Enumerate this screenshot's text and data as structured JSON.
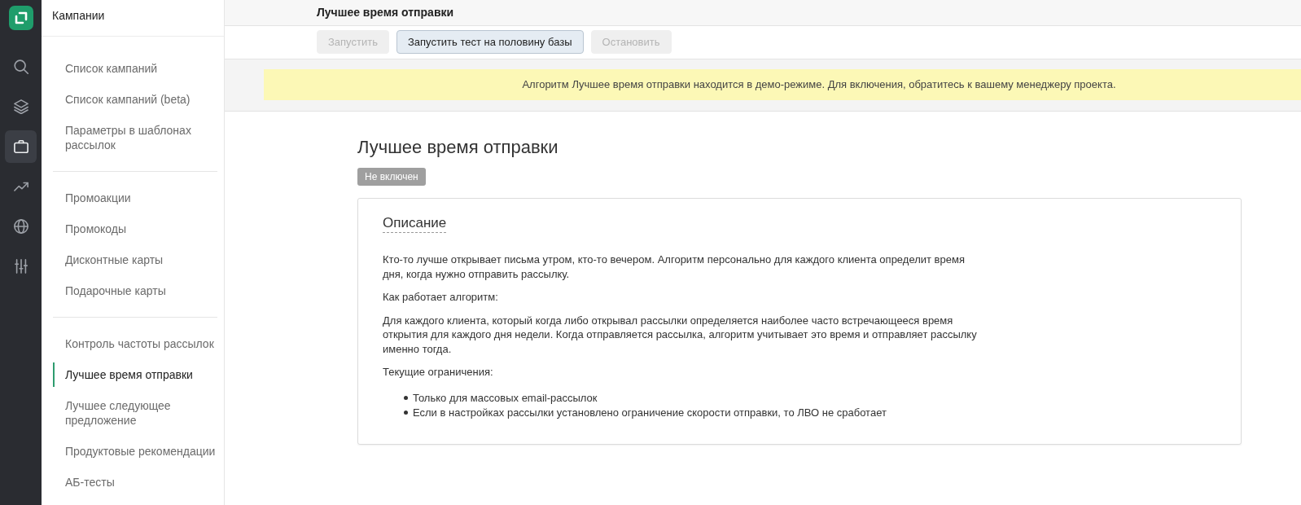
{
  "rail": {
    "items": [
      {
        "selected": false
      },
      {
        "selected": false
      },
      {
        "selected": true
      },
      {
        "selected": false
      },
      {
        "selected": false
      },
      {
        "selected": false
      }
    ]
  },
  "sidebar": {
    "title": "Кампании",
    "groups": [
      {
        "items": [
          {
            "label": "Список кампаний",
            "selected": false
          },
          {
            "label": "Список кампаний (beta)",
            "selected": false
          },
          {
            "label": "Параметры в шаблонах рассылок",
            "selected": false
          }
        ]
      },
      {
        "items": [
          {
            "label": "Промоакции",
            "selected": false
          },
          {
            "label": "Промокоды",
            "selected": false
          },
          {
            "label": "Дисконтные карты",
            "selected": false
          },
          {
            "label": "Подарочные карты",
            "selected": false
          }
        ]
      },
      {
        "items": [
          {
            "label": "Контроль частоты рассылок",
            "selected": false
          },
          {
            "label": "Лучшее время отправки",
            "selected": true
          },
          {
            "label": "Лучшее следующее предложение",
            "selected": false
          },
          {
            "label": "Продуктовые рекомендации",
            "selected": false
          },
          {
            "label": "АБ-тесты",
            "selected": false
          }
        ]
      }
    ]
  },
  "topbar": {
    "title": "Лучшее время отправки",
    "buttons": [
      {
        "label": "Запустить",
        "disabled": true
      },
      {
        "label": "Запустить тест на половину базы",
        "disabled": false
      },
      {
        "label": "Остановить",
        "disabled": true
      }
    ]
  },
  "notice": {
    "text": "Алгоритм Лучшее время отправки находится в демо-режиме. Для включения, обратитесь к вашему менеджеру проекта."
  },
  "feature": {
    "title": "Лучшее время отправки",
    "status": {
      "label": "Не включен"
    },
    "card": {
      "heading": "Описание",
      "blocks": [
        {
          "kind": "paragraph",
          "text": "Кто-то лучше открывает письма утром, кто-то вечером. Алгоритм персонально для каждого клиента определит время дня, когда нужно отправить рассылку."
        },
        {
          "kind": "paragraph",
          "text": "Как работает алгоритм:"
        },
        {
          "kind": "paragraph",
          "text": "Для каждого клиента, который когда либо открывал рассылки определяется наиболее часто встречающееся время открытия для каждого дня недели. Когда отправляется рассылка, алгоритм учитывает это время и отправляет рассылку именно тогда."
        },
        {
          "kind": "paragraph",
          "text": "Текущие ограничения:"
        },
        {
          "kind": "list",
          "items": [
            "Только для массовых email-рассылок",
            "Если в настройках рассылки установлено ограничение скорости отправки, то ЛВО не сработает"
          ]
        }
      ]
    }
  }
}
